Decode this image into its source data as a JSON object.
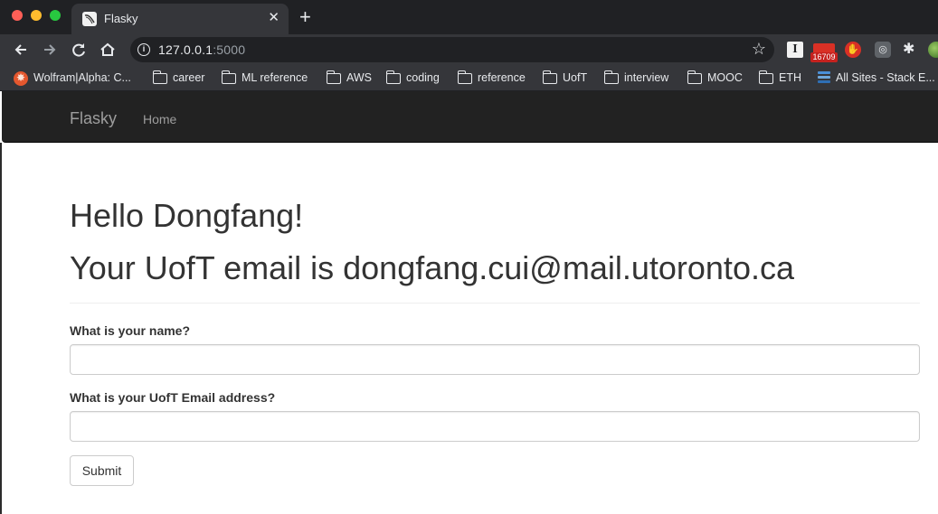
{
  "browser": {
    "tab": {
      "title": "Flasky",
      "close_glyph": "✕",
      "favicon": "flask-favicon-icon"
    },
    "new_tab_glyph": "+",
    "url": {
      "host": "127.0.0.1",
      "port": ":5000"
    },
    "extensions": {
      "mail_badge": "16709"
    },
    "bookmarks": [
      {
        "label": "Wolfram|Alpha: C...",
        "icon": "wolfram-icon"
      },
      {
        "label": "career",
        "icon": "folder-icon"
      },
      {
        "label": "ML reference",
        "icon": "folder-icon"
      },
      {
        "label": "AWS",
        "icon": "folder-icon"
      },
      {
        "label": "coding",
        "icon": "folder-icon"
      },
      {
        "label": "reference",
        "icon": "folder-icon"
      },
      {
        "label": "UofT",
        "icon": "folder-icon"
      },
      {
        "label": "interview",
        "icon": "folder-icon"
      },
      {
        "label": "MOOC",
        "icon": "folder-icon"
      },
      {
        "label": "ETH",
        "icon": "folder-icon"
      },
      {
        "label": "All Sites - Stack E...",
        "icon": "stack-exchange-icon"
      }
    ]
  },
  "navbar": {
    "brand": "Flasky",
    "home": "Home"
  },
  "main": {
    "greeting": "Hello Dongfang!",
    "email_heading": "Your UofT email is dongfang.cui@mail.utoronto.ca"
  },
  "form": {
    "name_label": "What is your name?",
    "name_value": "",
    "email_label": "What is your UofT Email address?",
    "email_value": "",
    "submit_label": "Submit"
  },
  "colors": {
    "navbar_bg": "#222222",
    "navbar_text": "#9d9d9d",
    "heading_text": "#333333",
    "chrome_bg": "#35363a"
  }
}
